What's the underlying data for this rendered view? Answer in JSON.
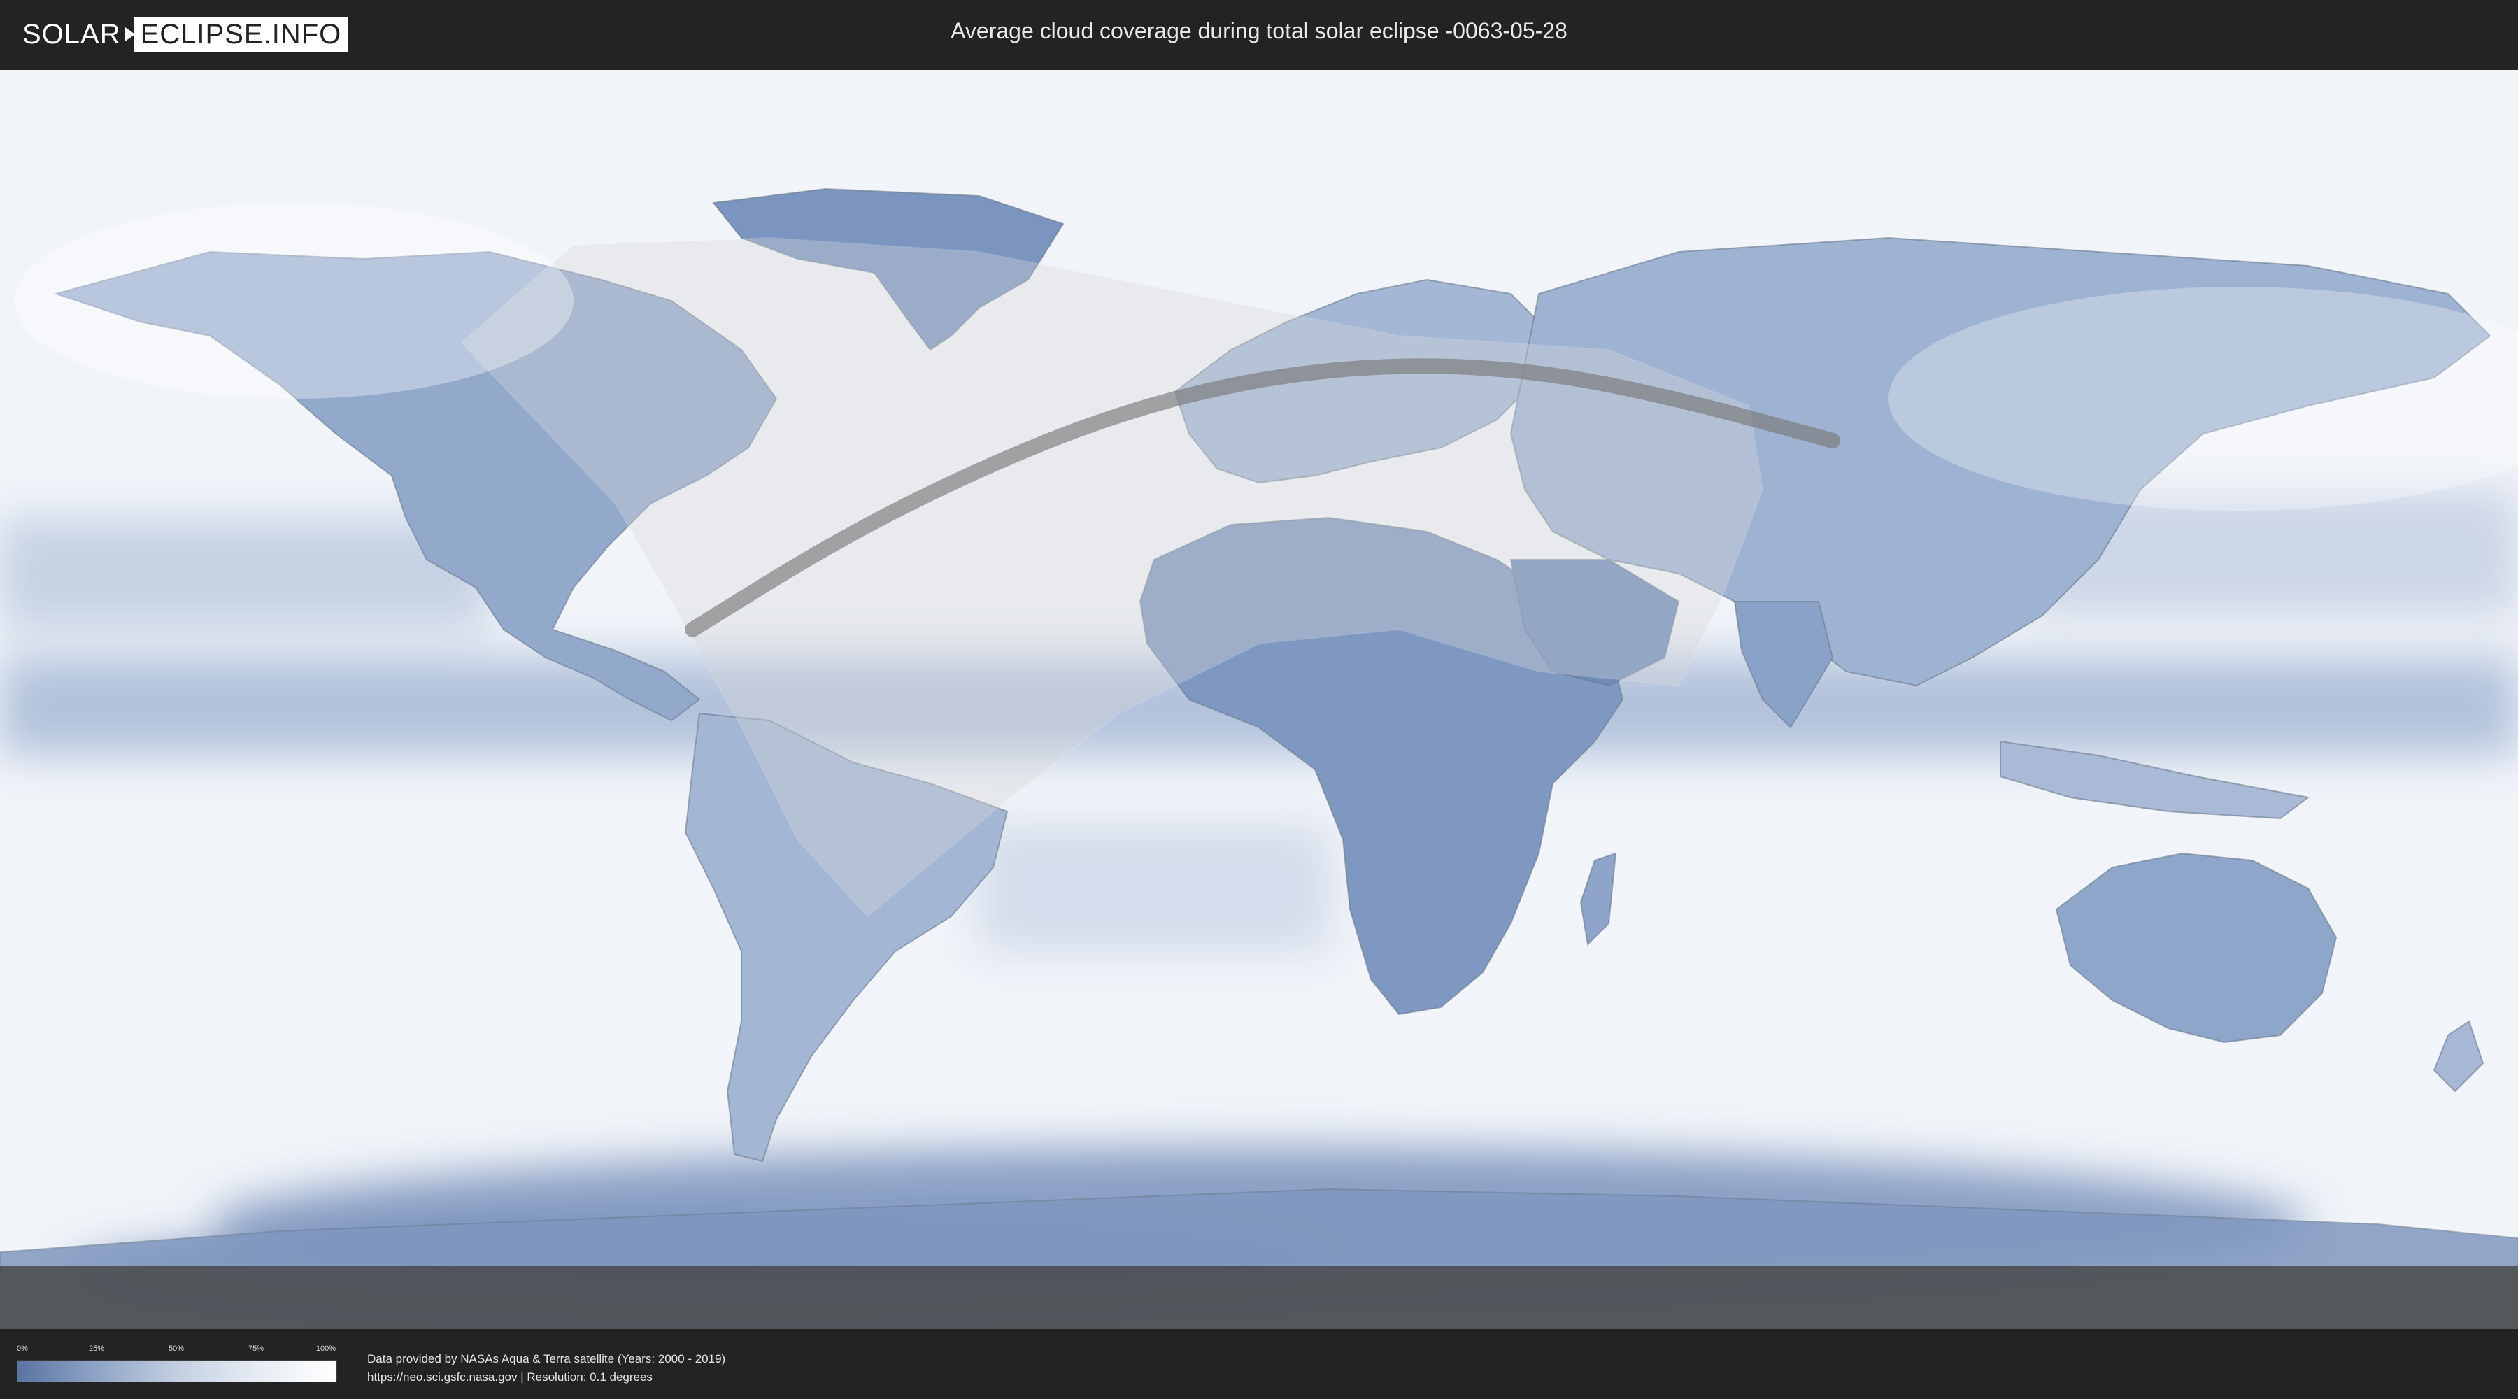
{
  "header": {
    "logo_left": "SOLAR",
    "logo_right": "ECLIPSE.INFO",
    "title": "Average cloud coverage during total solar eclipse -0063-05-28"
  },
  "legend": {
    "ticks": [
      "0%",
      "25%",
      "50%",
      "75%",
      "100%"
    ],
    "tick_fractions": [
      0,
      0.25,
      0.5,
      0.75,
      1.0
    ],
    "color_low": "#5a73a1",
    "color_high": "#ffffff"
  },
  "footer": {
    "credit_line": "Data provided by NASAs Aqua & Terra satellite (Years: 2000 - 2019)",
    "source_line": "https://neo.sci.gsfc.nasa.gov | Resolution: 0.1 degrees"
  },
  "map": {
    "projection": "equirectangular",
    "colors": {
      "clear_sky": "#5e7aa8",
      "cloudy": "#f4f7fb",
      "land_outline": "#6b7a8c",
      "eclipse_path": "#7a7a7a",
      "shadow_region": "#d8d8d8",
      "night_shade": "#4a4a4a"
    },
    "eclipse_centerline": [
      {
        "lon": -81,
        "lat": 10
      },
      {
        "lon": -60,
        "lat": 23
      },
      {
        "lon": -40,
        "lat": 33
      },
      {
        "lon": -20,
        "lat": 41
      },
      {
        "lon": 0,
        "lat": 46
      },
      {
        "lon": 20,
        "lat": 48
      },
      {
        "lon": 40,
        "lat": 47
      },
      {
        "lon": 60,
        "lat": 43
      },
      {
        "lon": 82,
        "lat": 37
      }
    ]
  }
}
